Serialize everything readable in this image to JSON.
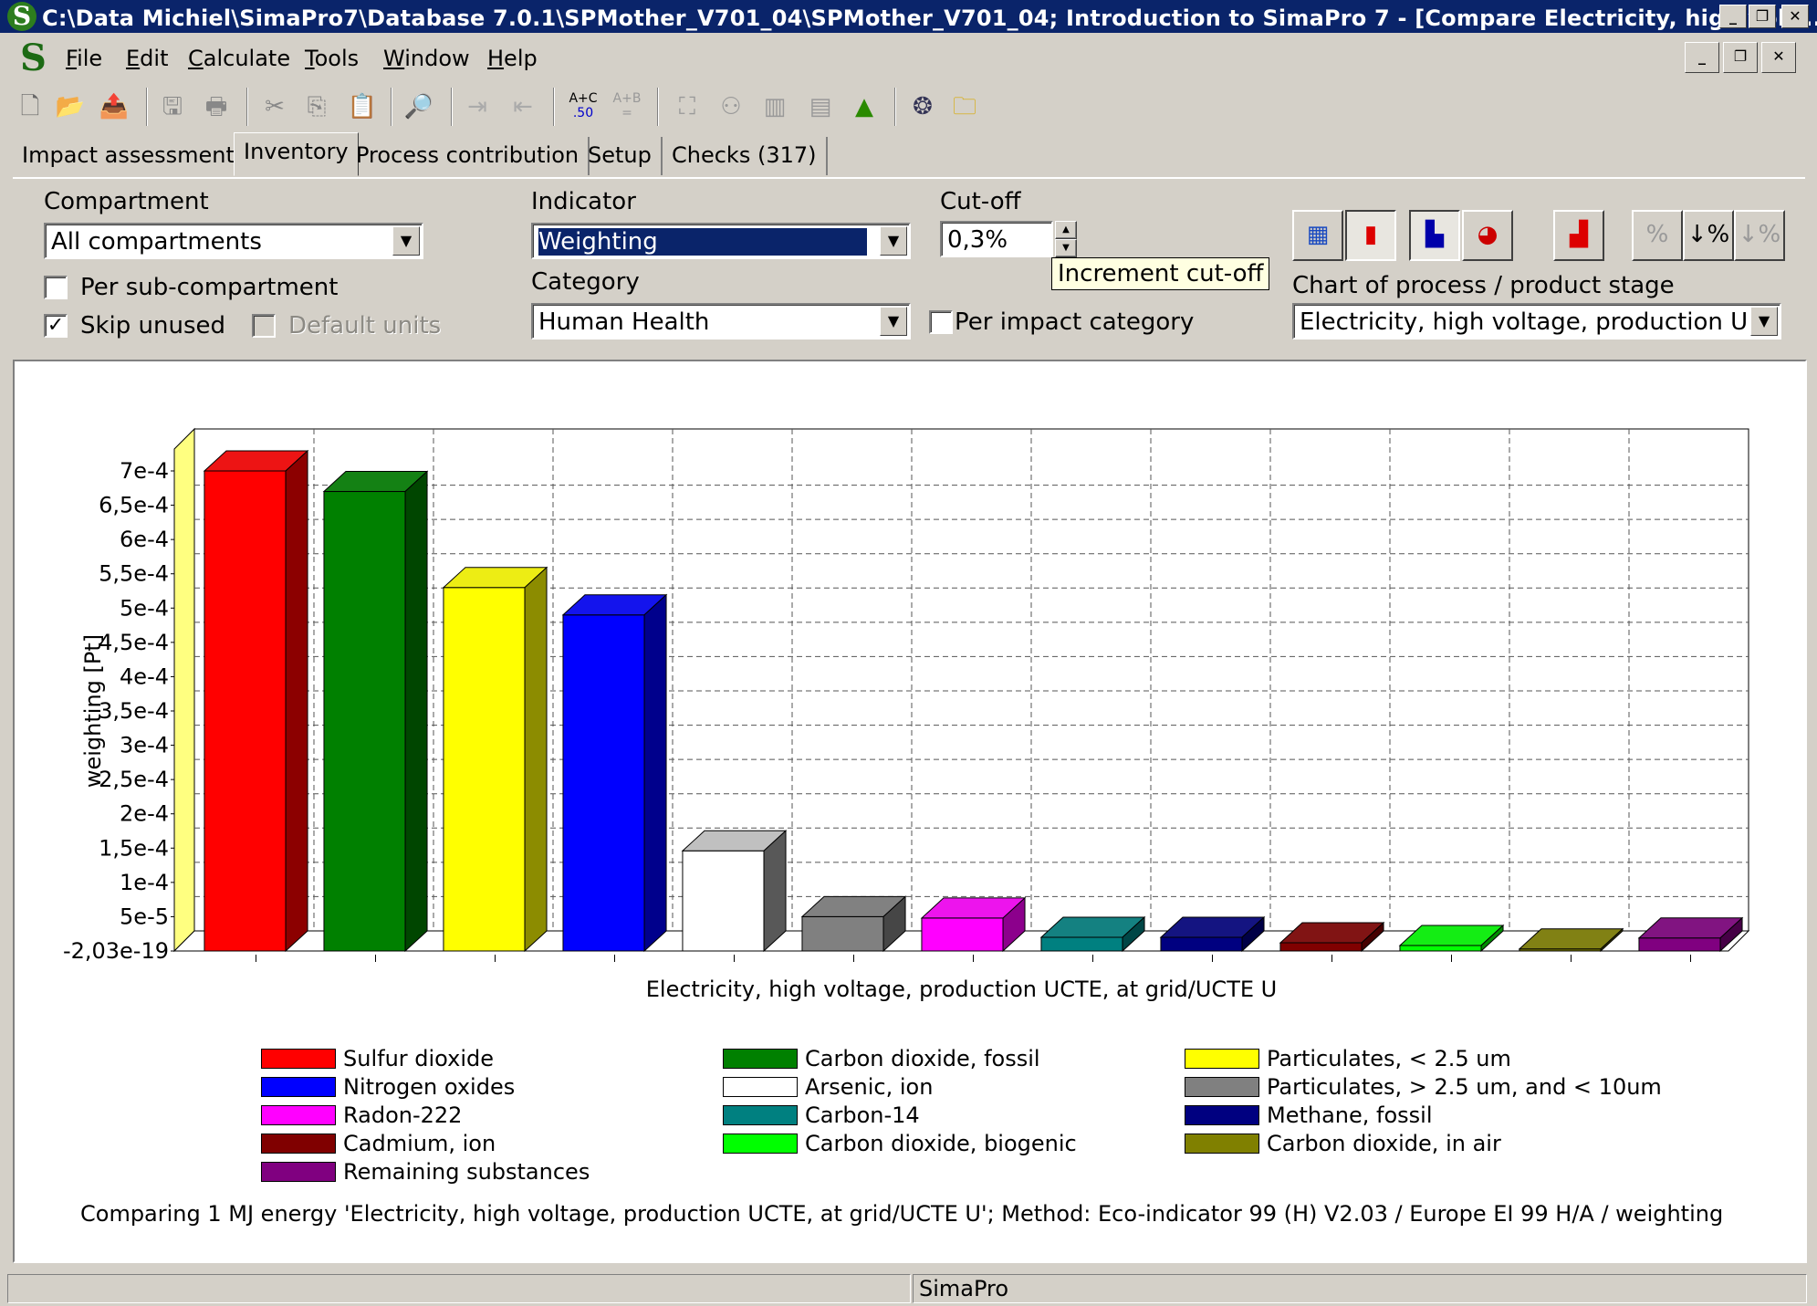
{
  "window": {
    "title": "C:\\Data Michiel\\SimaPro7\\Database 7.0.1\\SPMother_V701_04\\SPMother_V701_04; Introduction to SimaPro 7 - [Compare Electricity, high volt...",
    "logo": "S"
  },
  "menu": [
    {
      "label": "File",
      "u": "F"
    },
    {
      "label": "Edit",
      "u": "E"
    },
    {
      "label": "Calculate",
      "u": "C"
    },
    {
      "label": "Tools",
      "u": "T"
    },
    {
      "label": "Window",
      "u": "W"
    },
    {
      "label": "Help",
      "u": "H"
    }
  ],
  "toolbar": {
    "icons": [
      "new-icon",
      "open-icon",
      "import-icon",
      "save-icon",
      "print-icon",
      "cut-icon",
      "copy-icon",
      "paste-icon",
      "find-icon",
      "indent-icon",
      "outdent-icon",
      "compare-icon",
      "compare-b-icon",
      "network-icon",
      "tree-icon",
      "bar-chart-icon",
      "stacked-chart-icon",
      "single-score-icon",
      "info-icon",
      "folder-icon"
    ],
    "compare_label": "A+C",
    "compare_sub": ".50",
    "compare_b_label": "A+B"
  },
  "tabs": [
    {
      "label": "Impact assessment",
      "active": false
    },
    {
      "label": "Inventory",
      "active": true
    },
    {
      "label": "Process contribution",
      "active": false
    },
    {
      "label": "Setup",
      "active": false
    },
    {
      "label": "Checks (317)",
      "active": false
    }
  ],
  "options": {
    "compartment_label": "Compartment",
    "compartment_value": "All compartments",
    "per_subcompartment_label": "Per sub-compartment",
    "per_subcompartment_checked": false,
    "skip_unused_label": "Skip unused",
    "skip_unused_checked": true,
    "default_units_label": "Default units",
    "default_units_checked": false,
    "indicator_label": "Indicator",
    "indicator_value": "Weighting",
    "category_label": "Category",
    "category_value": "Human Health",
    "cutoff_label": "Cut-off",
    "cutoff_value": "0,3%",
    "per_impact_category_label": "Per impact category",
    "per_impact_category_checked": false,
    "tooltip": "Increment cut-off",
    "chart_of_label": "Chart of process / product stage",
    "chart_of_value": "Electricity, high voltage, production UC"
  },
  "chart_data": {
    "type": "bar",
    "ylabel": "weighting [Pt]",
    "xlabel": "Electricity, high voltage, production UCTE, at grid/UCTE U",
    "ylim": [
      0,
      0.0007
    ],
    "yticks": [
      "7e-4",
      "6,5e-4",
      "6e-4",
      "5,5e-4",
      "5e-4",
      "4,5e-4",
      "4e-4",
      "3,5e-4",
      "3e-4",
      "2,5e-4",
      "2e-4",
      "1,5e-4",
      "1e-4",
      "5e-5",
      "-2,03e-19"
    ],
    "grid": true,
    "legend_position": "bottom",
    "series": [
      {
        "name": "Sulfur dioxide",
        "value": 0.0007,
        "color": "#ff0000"
      },
      {
        "name": "Carbon dioxide, fossil",
        "value": 0.00067,
        "color": "#008000"
      },
      {
        "name": "Particulates, < 2.5 um",
        "value": 0.00053,
        "color": "#ffff00"
      },
      {
        "name": "Nitrogen oxides",
        "value": 0.00049,
        "color": "#0000ff"
      },
      {
        "name": "Arsenic, ion",
        "value": 0.000146,
        "color": "#ffffff"
      },
      {
        "name": "Particulates, > 2.5 um, and < 10um",
        "value": 5e-05,
        "color": "#808080"
      },
      {
        "name": "Radon-222",
        "value": 4.8e-05,
        "color": "#ff00ff"
      },
      {
        "name": "Carbon-14",
        "value": 2e-05,
        "color": "#008080"
      },
      {
        "name": "Methane, fossil",
        "value": 2e-05,
        "color": "#000080"
      },
      {
        "name": "Cadmium, ion",
        "value": 1.2e-05,
        "color": "#800000"
      },
      {
        "name": "Carbon dioxide, biogenic",
        "value": 8e-06,
        "color": "#00ff00"
      },
      {
        "name": "Carbon dioxide, in air",
        "value": 3e-06,
        "color": "#808000"
      },
      {
        "name": "Remaining substances",
        "value": 1.9e-05,
        "color": "#800080"
      }
    ]
  },
  "caption": "Comparing 1 MJ energy 'Electricity, high voltage, production UCTE, at grid/UCTE U';  Method: Eco-indicator 99 (H) V2.03 /  Europe EI 99 H/A / weighting",
  "status": {
    "app": "SimaPro"
  }
}
